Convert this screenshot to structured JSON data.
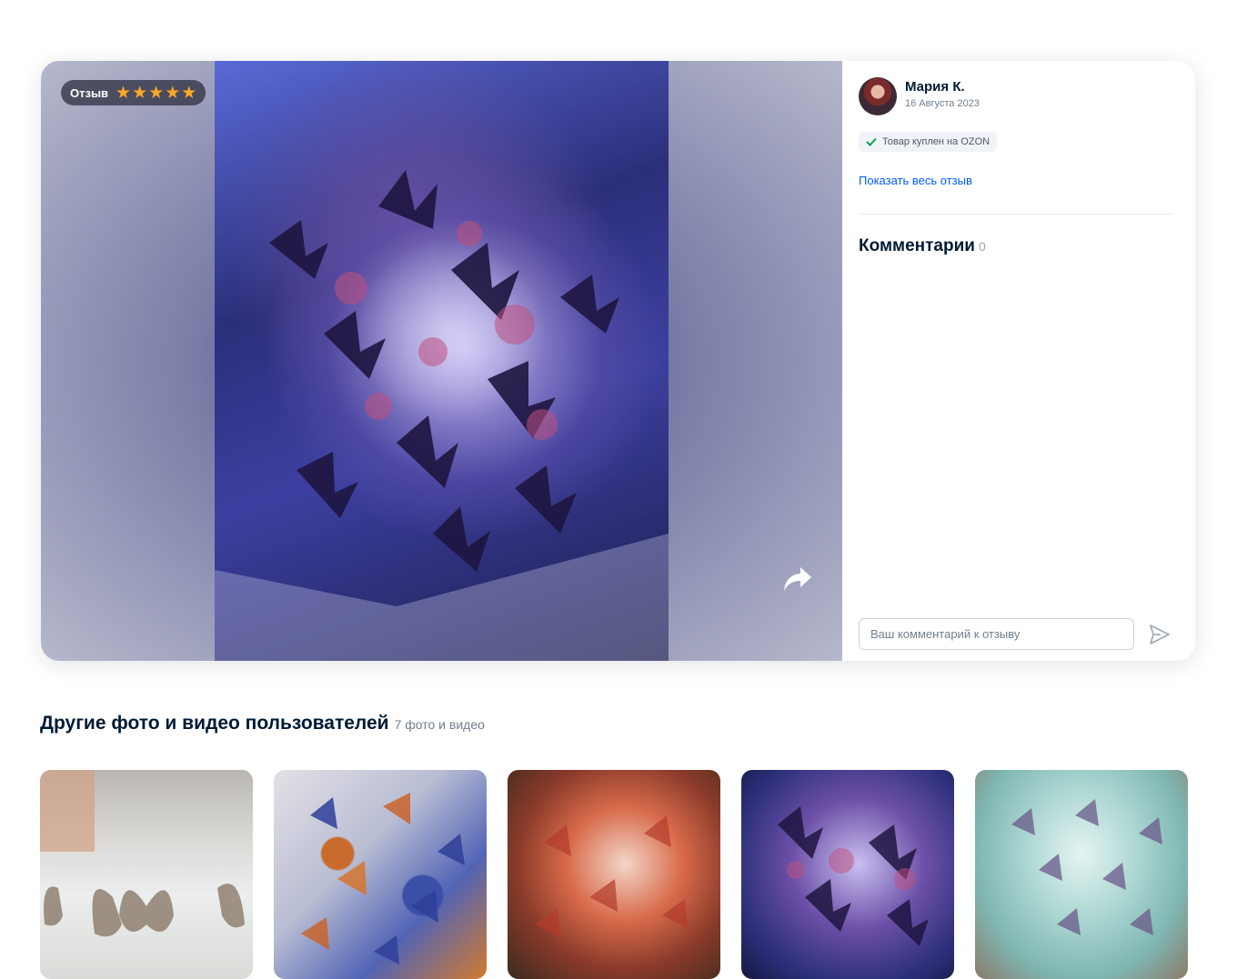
{
  "review": {
    "badge_label": "Отзыв",
    "rating": 5,
    "user_name": "Мария К.",
    "date": "16 Августа 2023",
    "bought_label": "Товар куплен на OZON",
    "show_full_label": "Показать весь отзыв"
  },
  "comments": {
    "title": "Комментарии",
    "count": "0",
    "input_placeholder": "Ваш комментарий к отзыву"
  },
  "gallery": {
    "title": "Другие фото и видео пользователей",
    "count_label": "7 фото и видео"
  },
  "colors": {
    "accent_link": "#005bff",
    "star": "#f9a825",
    "text_primary": "#001a34",
    "text_secondary": "#707f8d"
  },
  "icons": [
    "star-icon",
    "share-icon",
    "check-icon",
    "send-icon"
  ]
}
